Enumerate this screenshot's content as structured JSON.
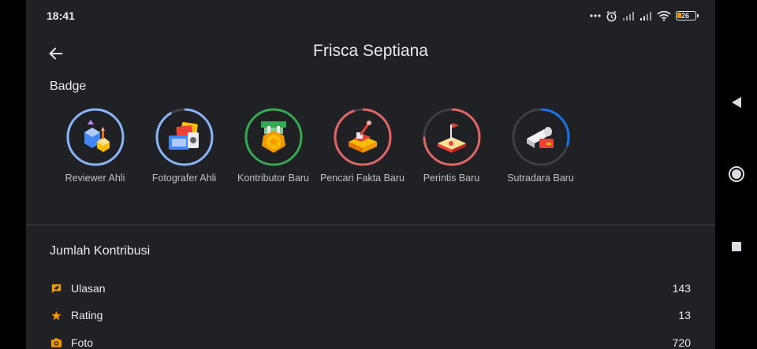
{
  "status_bar": {
    "time": "18:41",
    "battery_level": "26"
  },
  "app_bar": {
    "title": "Frisca Septiana"
  },
  "badge_section": {
    "heading": "Badge",
    "badges": [
      {
        "label": "Reviewer Ahli",
        "ring_color": "#8ab4f8",
        "progress": 1.0,
        "icon": "reviewer-badge-icon"
      },
      {
        "label": "Fotografer Ahli",
        "ring_color": "#8ab4f8",
        "progress": 0.92,
        "icon": "photographer-badge-icon"
      },
      {
        "label": "Kontributor Baru",
        "ring_color": "#34a853",
        "progress": 1.0,
        "icon": "contributor-badge-icon"
      },
      {
        "label": "Pencari Fakta Baru",
        "ring_color": "#e06666",
        "progress": 0.95,
        "icon": "fact-finder-badge-icon"
      },
      {
        "label": "Perintis Baru",
        "ring_color": "#e06666",
        "progress": 0.75,
        "icon": "pioneer-badge-icon"
      },
      {
        "label": "Sutradara Baru",
        "ring_color": "#1a73e8",
        "progress": 0.3,
        "icon": "director-badge-icon"
      }
    ]
  },
  "contributions": {
    "heading": "Jumlah Kontribusi",
    "accent_color": "#f29900",
    "items": [
      {
        "label": "Ulasan",
        "count": "143",
        "icon": "review-icon"
      },
      {
        "label": "Rating",
        "count": "13",
        "icon": "star-icon"
      },
      {
        "label": "Foto",
        "count": "720",
        "icon": "camera-icon"
      }
    ]
  }
}
